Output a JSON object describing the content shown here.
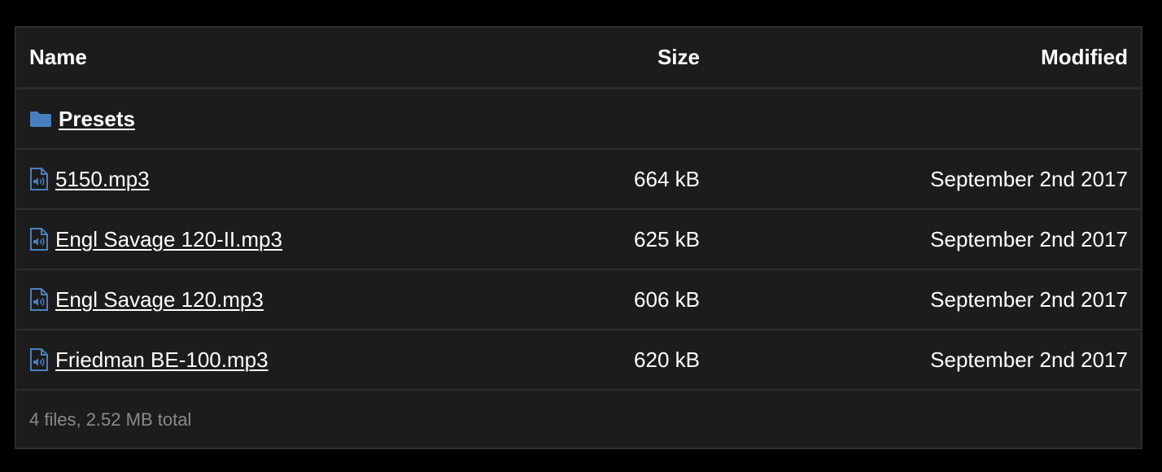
{
  "header": {
    "name": "Name",
    "size": "Size",
    "modified": "Modified"
  },
  "folder": {
    "name": "Presets",
    "icon": "folder-icon",
    "icon_color": "#4a7fbf"
  },
  "files": [
    {
      "name": "5150.mp3",
      "size": "664 kB",
      "modified": "September 2nd 2017",
      "icon": "audio-file-icon"
    },
    {
      "name": "Engl Savage 120-II.mp3",
      "size": "625 kB",
      "modified": "September 2nd 2017",
      "icon": "audio-file-icon"
    },
    {
      "name": "Engl Savage 120.mp3",
      "size": "606 kB",
      "modified": "September 2nd 2017",
      "icon": "audio-file-icon"
    },
    {
      "name": "Friedman BE-100.mp3",
      "size": "620 kB",
      "modified": "September 2nd 2017",
      "icon": "audio-file-icon"
    }
  ],
  "footer": {
    "summary": "4 files, 2.52 MB total"
  },
  "colors": {
    "background": "#000000",
    "panel": "#1c1c1c",
    "text": "#ffffff",
    "muted": "#8a8a8a",
    "accent": "#4a7fbf"
  }
}
